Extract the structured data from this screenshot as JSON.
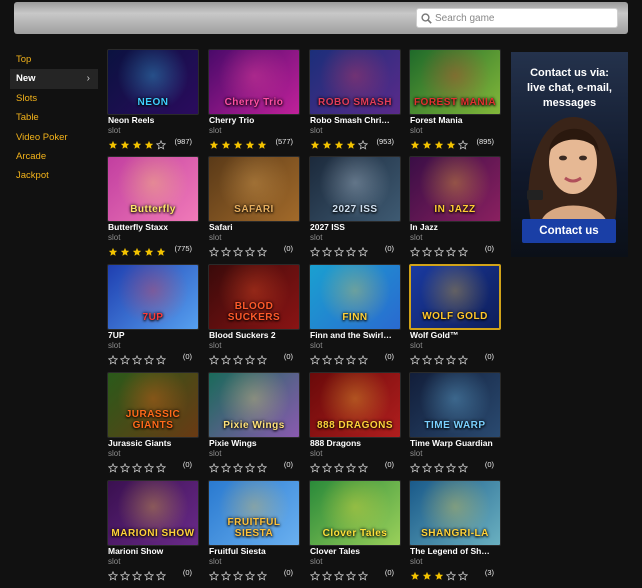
{
  "search": {
    "placeholder": "Search game"
  },
  "sidebar": {
    "items": [
      {
        "label": "Top",
        "active": false
      },
      {
        "label": "New",
        "active": true
      },
      {
        "label": "Slots",
        "active": false
      },
      {
        "label": "Table",
        "active": false
      },
      {
        "label": "Video Poker",
        "active": false
      },
      {
        "label": "Arcade",
        "active": false
      },
      {
        "label": "Jackpot",
        "active": false
      }
    ]
  },
  "games": [
    {
      "title": "Neon Reels",
      "type": "slot",
      "stars": 4,
      "count": "(987)",
      "art": "NEON",
      "bg": [
        "#0b1240",
        "#2b0b5e"
      ],
      "accent": "#3fd0ff"
    },
    {
      "title": "Cherry Trio",
      "type": "slot",
      "stars": 5,
      "count": "(577)",
      "art": "Cherry Trio",
      "bg": [
        "#4a0a6a",
        "#c0219a"
      ],
      "accent": "#ff4fa3"
    },
    {
      "title": "Robo Smash Chri…",
      "type": "slot",
      "stars": 4,
      "count": "(953)",
      "art": "ROBO SMASH",
      "bg": [
        "#1b2f7a",
        "#5a2a8a"
      ],
      "accent": "#e23c5a"
    },
    {
      "title": "Forest Mania",
      "type": "slot",
      "stars": 4,
      "count": "(895)",
      "art": "FOREST MANIA",
      "bg": [
        "#1f6a2a",
        "#83b83a"
      ],
      "accent": "#e23030"
    },
    {
      "title": "Butterfly Staxx",
      "type": "slot",
      "stars": 5,
      "count": "(775)",
      "art": "Butterfly",
      "bg": [
        "#c23fa0",
        "#f07ab8"
      ],
      "accent": "#ffe66a"
    },
    {
      "title": "Safari",
      "type": "slot",
      "stars": 0,
      "count": "(0)",
      "art": "SAFARI",
      "bg": [
        "#5a3a18",
        "#a26a2a"
      ],
      "accent": "#e8b060"
    },
    {
      "title": "2027 ISS",
      "type": "slot",
      "stars": 0,
      "count": "(0)",
      "art": "2027 ISS",
      "bg": [
        "#1c2a3c",
        "#3e5a72"
      ],
      "accent": "#d0e0f0"
    },
    {
      "title": "In Jazz",
      "type": "slot",
      "stars": 0,
      "count": "(0)",
      "art": "IN JAZZ",
      "bg": [
        "#3a0e46",
        "#8a2060"
      ],
      "accent": "#ffcc33"
    },
    {
      "title": "7UP",
      "type": "slot",
      "stars": 0,
      "count": "(0)",
      "art": "7UP",
      "bg": [
        "#1f3fb0",
        "#56a0f0"
      ],
      "accent": "#ff3a3a"
    },
    {
      "title": "Blood Suckers 2",
      "type": "slot",
      "stars": 0,
      "count": "(0)",
      "art": "BLOOD SUCKERS",
      "bg": [
        "#3a0a0a",
        "#8a1414"
      ],
      "accent": "#ff5a2a"
    },
    {
      "title": "Finn and the Swirl…",
      "type": "slot",
      "stars": 0,
      "count": "(0)",
      "art": "FINN",
      "bg": [
        "#1aa0d0",
        "#2a6ad0"
      ],
      "accent": "#ffd23a"
    },
    {
      "title": "Wolf Gold™",
      "type": "slot",
      "stars": 0,
      "count": "(0)",
      "art": "WOLF GOLD",
      "bg": [
        "#1a3aa0",
        "#0e1e5a"
      ],
      "accent": "#ffc72a"
    },
    {
      "title": "Jurassic Giants",
      "type": "slot",
      "stars": 0,
      "count": "(0)",
      "art": "JURASSIC GIANTS",
      "bg": [
        "#2a5a1a",
        "#6a3a14"
      ],
      "accent": "#ff6a1a"
    },
    {
      "title": "Pixie Wings",
      "type": "slot",
      "stars": 0,
      "count": "(0)",
      "art": "Pixie Wings",
      "bg": [
        "#1a6a5a",
        "#8a5ab0"
      ],
      "accent": "#ffe27a"
    },
    {
      "title": "888 Dragons",
      "type": "slot",
      "stars": 0,
      "count": "(0)",
      "art": "888 DRAGONS",
      "bg": [
        "#6a0a0a",
        "#b01e1e"
      ],
      "accent": "#ffd23a"
    },
    {
      "title": "Time Warp Guardian",
      "type": "slot",
      "stars": 0,
      "count": "(0)",
      "art": "TIME WARP",
      "bg": [
        "#121e3a",
        "#2a4a70"
      ],
      "accent": "#7ad0ff"
    },
    {
      "title": "Marioni Show",
      "type": "slot",
      "stars": 0,
      "count": "(0)",
      "art": "MARIONI SHOW",
      "bg": [
        "#3a1050",
        "#6a2a8a"
      ],
      "accent": "#ffd23a"
    },
    {
      "title": "Fruitful Siesta",
      "type": "slot",
      "stars": 0,
      "count": "(0)",
      "art": "FRUITFUL SIESTA",
      "bg": [
        "#2a7ad0",
        "#6ab0f0"
      ],
      "accent": "#ffc23a"
    },
    {
      "title": "Clover Tales",
      "type": "slot",
      "stars": 0,
      "count": "(0)",
      "art": "Clover Tales",
      "bg": [
        "#2a8a3a",
        "#9ad05a"
      ],
      "accent": "#ffe23a"
    },
    {
      "title": "The Legend of Sh…",
      "type": "slot",
      "stars": 3,
      "count": "(3)",
      "art": "SHANGRI-LA",
      "bg": [
        "#1a5a8a",
        "#6ab0c0"
      ],
      "accent": "#ffd23a"
    }
  ],
  "ad": {
    "text_line1": "Contact us via:",
    "text_line2": "live chat, e-mail,",
    "text_line3": "messages",
    "button_label": "Contact us"
  },
  "colors": {
    "star_filled": "#f2c200",
    "star_empty": "#bdbdbd",
    "sidebar_link": "#f2b21a",
    "selected_border": "#d1a319"
  }
}
